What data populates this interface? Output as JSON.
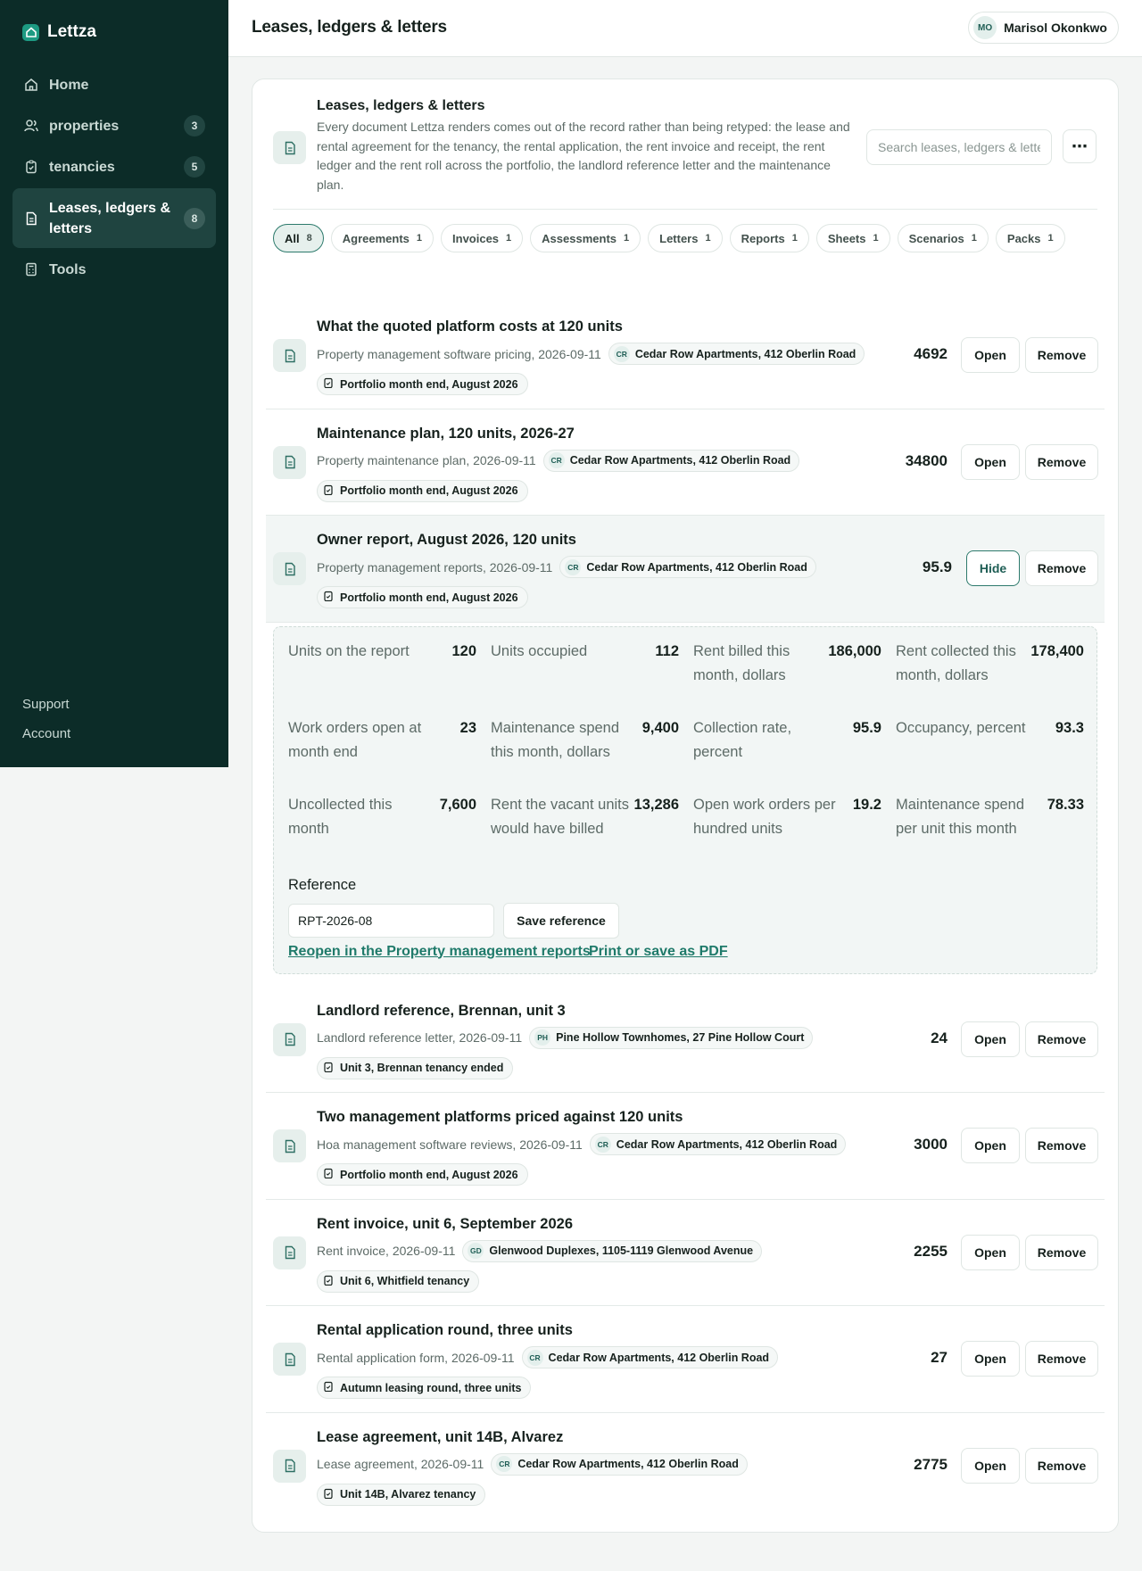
{
  "app": {
    "name": "Lettza"
  },
  "sidebar": {
    "items": [
      {
        "label": "Home",
        "icon": "home-icon"
      },
      {
        "label": "properties",
        "count": "3",
        "icon": "users-icon"
      },
      {
        "label": "tenancies",
        "count": "5",
        "icon": "clipboard-icon"
      },
      {
        "label": "Leases, ledgers & letters",
        "count": "8",
        "icon": "document-icon",
        "active": true
      },
      {
        "label": "Tools",
        "icon": "calculator-icon"
      }
    ],
    "footer": {
      "support": "Support",
      "account": "Account"
    }
  },
  "topbar": {
    "title": "Leases, ledgers & letters"
  },
  "user": {
    "initials": "MO",
    "name": "Marisol Okonkwo"
  },
  "page": {
    "title": "Leases, ledgers & letters",
    "description": "Every document Lettza renders comes out of the record rather than being retyped: the lease and rental agreement for the tenancy, the rental application, the rent invoice and receipt, the rent ledger and the rent roll across the portfolio, the landlord reference letter and the maintenance plan.",
    "search_placeholder": "Search leases, ledgers & letters",
    "more_label": "⋯"
  },
  "filters": [
    {
      "label": "All",
      "count": "8",
      "active": true
    },
    {
      "label": "Agreements",
      "count": "1"
    },
    {
      "label": "Invoices",
      "count": "1"
    },
    {
      "label": "Assessments",
      "count": "1"
    },
    {
      "label": "Letters",
      "count": "1"
    },
    {
      "label": "Reports",
      "count": "1"
    },
    {
      "label": "Sheets",
      "count": "1"
    },
    {
      "label": "Scenarios",
      "count": "1"
    },
    {
      "label": "Packs",
      "count": "1"
    }
  ],
  "buttons": {
    "open": "Open",
    "hide": "Hide",
    "remove": "Remove"
  },
  "documents": [
    {
      "title": "What the quoted platform costs at 120 units",
      "type_date": "Property management software pricing, 2026-09-11",
      "prop_code": "CR",
      "property": "Cedar Row Apartments, 412 Oberlin Road",
      "tag": "Portfolio month end, August 2026",
      "value": "4692"
    },
    {
      "title": "Maintenance plan, 120 units, 2026-27",
      "type_date": "Property maintenance plan, 2026-09-11",
      "prop_code": "CR",
      "property": "Cedar Row Apartments, 412 Oberlin Road",
      "tag": "Portfolio month end, August 2026",
      "value": "34800"
    },
    {
      "title": "Owner report, August 2026, 120 units",
      "type_date": "Property management reports, 2026-09-11",
      "prop_code": "CR",
      "property": "Cedar Row Apartments, 412 Oberlin Road",
      "tag": "Portfolio month end, August 2026",
      "value": "95.9",
      "expanded": true
    },
    {
      "title": "Landlord reference, Brennan, unit 3",
      "type_date": "Landlord reference letter, 2026-09-11",
      "prop_code": "PH",
      "property": "Pine Hollow Townhomes, 27 Pine Hollow Court",
      "tag": "Unit 3, Brennan tenancy ended",
      "value": "24"
    },
    {
      "title": "Two management platforms priced against 120 units",
      "type_date": "Hoa management software reviews, 2026-09-11",
      "prop_code": "CR",
      "property": "Cedar Row Apartments, 412 Oberlin Road",
      "tag": "Portfolio month end, August 2026",
      "value": "3000"
    },
    {
      "title": "Rent invoice, unit 6, September 2026",
      "type_date": "Rent invoice, 2026-09-11",
      "prop_code": "GD",
      "property": "Glenwood Duplexes, 1105-1119 Glenwood Avenue",
      "tag": "Unit 6, Whitfield tenancy",
      "value": "2255"
    },
    {
      "title": "Rental application round, three units",
      "type_date": "Rental application form, 2026-09-11",
      "prop_code": "CR",
      "property": "Cedar Row Apartments, 412 Oberlin Road",
      "tag": "Autumn leasing round, three units",
      "value": "27"
    },
    {
      "title": "Lease agreement, unit 14B, Alvarez",
      "type_date": "Lease agreement, 2026-09-11",
      "prop_code": "CR",
      "property": "Cedar Row Apartments, 412 Oberlin Road",
      "tag": "Unit 14B, Alvarez tenancy",
      "value": "2775"
    }
  ],
  "report_detail": {
    "metrics": [
      {
        "label": "Units on the report",
        "value": "120"
      },
      {
        "label": "Units occupied",
        "value": "112"
      },
      {
        "label": "Rent billed this month, dollars",
        "value": "186,000"
      },
      {
        "label": "Rent collected this month, dollars",
        "value": "178,400"
      },
      {
        "label": "Work orders open at month end",
        "value": "23"
      },
      {
        "label": "Maintenance spend this month, dollars",
        "value": "9,400"
      },
      {
        "label": "Collection rate, percent",
        "value": "95.9"
      },
      {
        "label": "Occupancy, percent",
        "value": "93.3"
      },
      {
        "label": "Uncollected this month",
        "value": "7,600"
      },
      {
        "label": "Rent the vacant units would have billed",
        "value": "13,286"
      },
      {
        "label": "Open work orders per hundred units",
        "value": "19.2"
      },
      {
        "label": "Maintenance spend per unit this month",
        "value": "78.33"
      }
    ],
    "reference_label": "Reference",
    "reference_value": "RPT-2026-08",
    "save_reference": "Save reference",
    "reopen_link": "Reopen in the Property management reports",
    "print_link": "Print or save as PDF"
  },
  "colors": {
    "sidebar_bg": "#0c2c28",
    "accent": "#1f7a6a",
    "active_nav": "#1f4440"
  }
}
